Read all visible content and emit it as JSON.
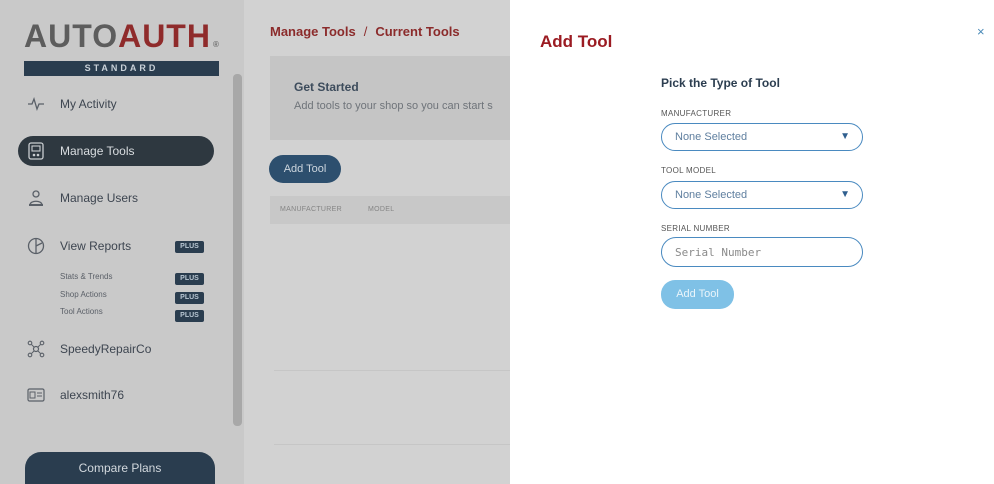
{
  "logo": {
    "part1": "AUTO",
    "part2": "AUTH",
    "registered": "®",
    "subtitle": "STANDARD"
  },
  "sidebar": {
    "items": [
      {
        "label": "My Activity",
        "icon": "activity-icon"
      },
      {
        "label": "Manage Tools",
        "icon": "tools-icon",
        "active": true
      },
      {
        "label": "Manage Users",
        "icon": "users-icon"
      },
      {
        "label": "View Reports",
        "icon": "reports-icon",
        "badge": "PLUS"
      },
      {
        "label": "SpeedyRepairCo",
        "icon": "company-icon"
      },
      {
        "label": "alexsmith76",
        "icon": "id-card-icon"
      }
    ],
    "sub_items": [
      {
        "label": "Stats & Trends",
        "badge": "PLUS"
      },
      {
        "label": "Shop Actions",
        "badge": "PLUS"
      },
      {
        "label": "Tool Actions",
        "badge": "PLUS"
      }
    ],
    "compare_label": "Compare Plans"
  },
  "main": {
    "breadcrumb": {
      "first": "Manage Tools",
      "sep": "/",
      "second": "Current Tools"
    },
    "get_started": {
      "title": "Get Started",
      "text": "Add tools to your shop so you can start s"
    },
    "add_tool_label": "Add Tool",
    "table_headers": [
      "MANUFACTURER",
      "MODEL"
    ]
  },
  "modal": {
    "title": "Add Tool",
    "close": "×",
    "heading": "Pick the Type of Tool",
    "manufacturer_label": "MANUFACTURER",
    "manufacturer_value": "None Selected",
    "model_label": "TOOL MODEL",
    "model_value": "None Selected",
    "serial_label": "SERIAL NUMBER",
    "serial_placeholder": "Serial Number",
    "add_label": "Add Tool"
  },
  "colors": {
    "brand_red": "#9b1b22",
    "navy": "#2a3d4f",
    "accent_blue": "#4a8ac0",
    "button_light_blue": "#7fc1e6"
  }
}
